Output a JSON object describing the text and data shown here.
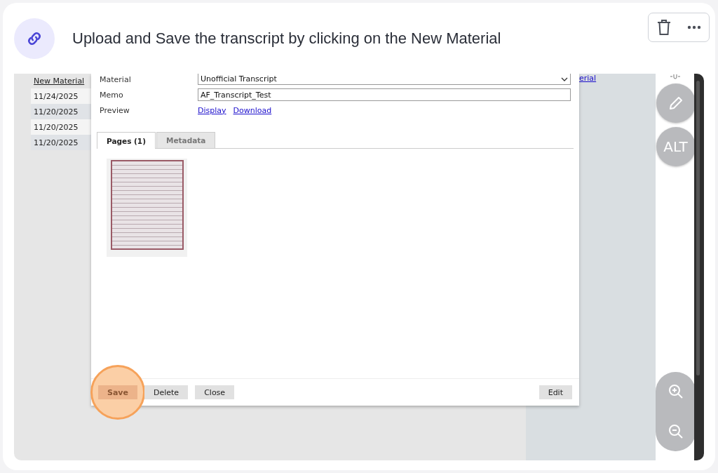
{
  "header": {
    "title": "Upload and Save the transcript by clicking on the New Material"
  },
  "screenshot": {
    "list": {
      "link": "New Material",
      "dates": [
        "11/24/2025",
        "11/20/2025",
        "11/20/2025",
        "11/20/2025"
      ]
    },
    "right_link": "erial",
    "dialog": {
      "fields": [
        {
          "kind": "select",
          "label": "Material",
          "value": "Unofficial Transcript"
        },
        {
          "kind": "text",
          "label": "Memo",
          "value": "AF_Transcript_Test"
        },
        {
          "kind": "links",
          "label": "Preview",
          "links": [
            "Display",
            "Download"
          ]
        }
      ],
      "tabs": [
        {
          "label": "Pages (1)",
          "selected": true
        },
        {
          "label": "Metadata",
          "selected": false
        }
      ],
      "buttons": [
        {
          "label": "Save",
          "highlighted": true
        },
        {
          "label": "Delete",
          "highlighted": false
        },
        {
          "label": "Close",
          "highlighted": false
        }
      ],
      "edit_button": "Edit"
    },
    "tools": {
      "alt": "ALT"
    }
  }
}
